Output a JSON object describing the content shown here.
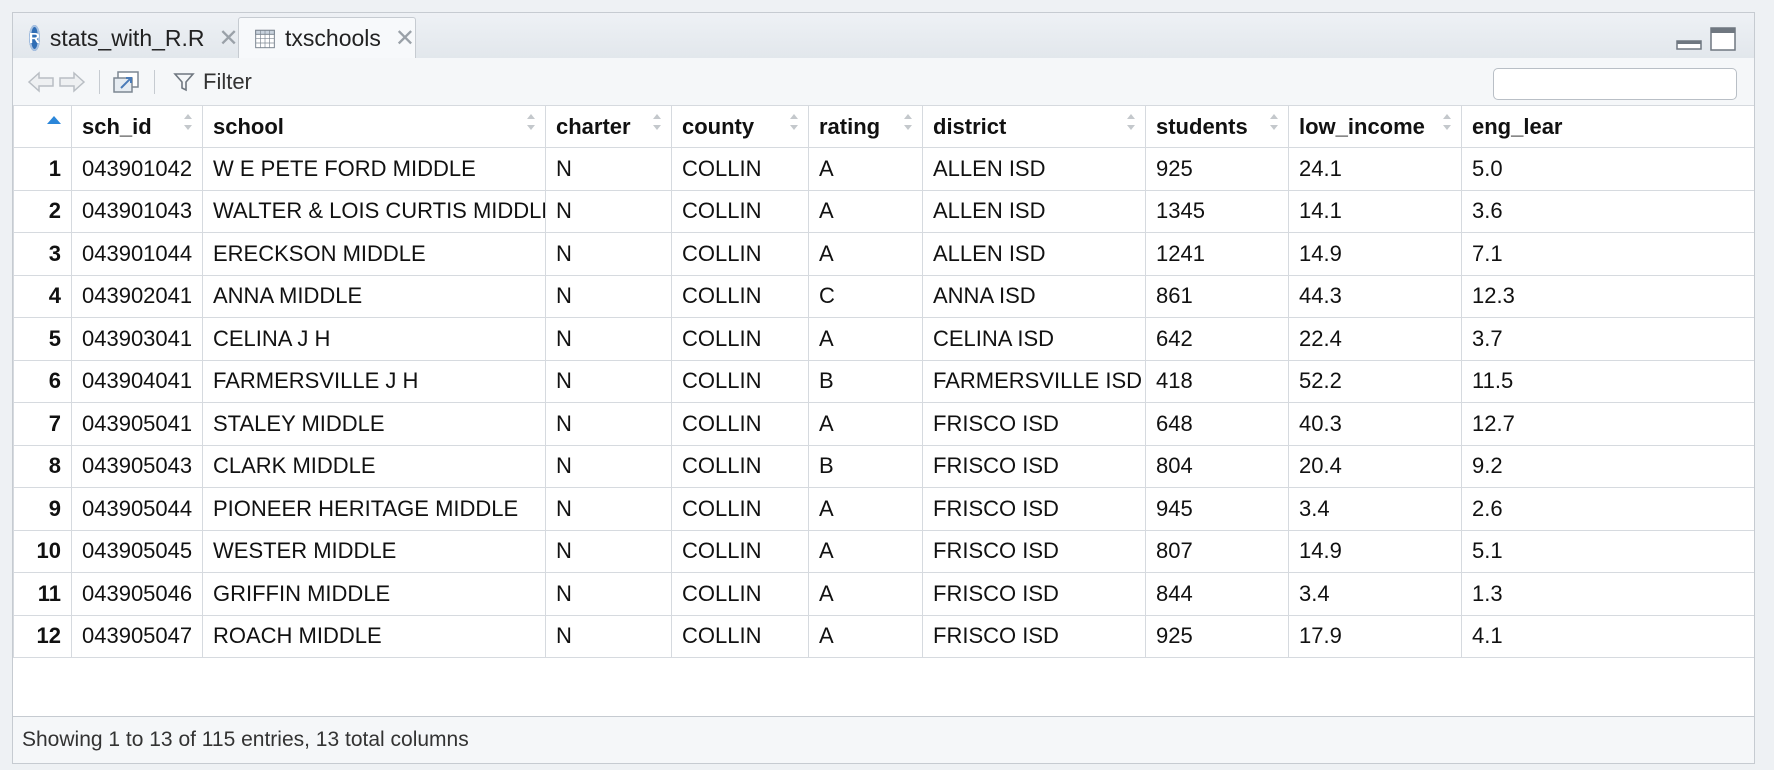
{
  "tabs": [
    {
      "label": "stats_with_R.R",
      "icon": "r-script-icon"
    },
    {
      "label": "txschools",
      "icon": "data-grid-icon"
    }
  ],
  "toolbar": {
    "filter_label": "Filter",
    "search_placeholder": ""
  },
  "table": {
    "columns": [
      "sch_id",
      "school",
      "charter",
      "county",
      "rating",
      "district",
      "students",
      "low_income",
      "eng_lear"
    ],
    "rows": [
      {
        "n": "1",
        "cells": [
          "043901042",
          "W E PETE FORD MIDDLE",
          "N",
          "COLLIN",
          "A",
          "ALLEN ISD",
          "925",
          "24.1",
          "5.0"
        ]
      },
      {
        "n": "2",
        "cells": [
          "043901043",
          "WALTER & LOIS CURTIS MIDDLE",
          "N",
          "COLLIN",
          "A",
          "ALLEN ISD",
          "1345",
          "14.1",
          "3.6"
        ]
      },
      {
        "n": "3",
        "cells": [
          "043901044",
          "ERECKSON MIDDLE",
          "N",
          "COLLIN",
          "A",
          "ALLEN ISD",
          "1241",
          "14.9",
          "7.1"
        ]
      },
      {
        "n": "4",
        "cells": [
          "043902041",
          "ANNA MIDDLE",
          "N",
          "COLLIN",
          "C",
          "ANNA ISD",
          "861",
          "44.3",
          "12.3"
        ]
      },
      {
        "n": "5",
        "cells": [
          "043903041",
          "CELINA J H",
          "N",
          "COLLIN",
          "A",
          "CELINA ISD",
          "642",
          "22.4",
          "3.7"
        ]
      },
      {
        "n": "6",
        "cells": [
          "043904041",
          "FARMERSVILLE J H",
          "N",
          "COLLIN",
          "B",
          "FARMERSVILLE ISD",
          "418",
          "52.2",
          "11.5"
        ]
      },
      {
        "n": "7",
        "cells": [
          "043905041",
          "STALEY MIDDLE",
          "N",
          "COLLIN",
          "A",
          "FRISCO ISD",
          "648",
          "40.3",
          "12.7"
        ]
      },
      {
        "n": "8",
        "cells": [
          "043905043",
          "CLARK MIDDLE",
          "N",
          "COLLIN",
          "B",
          "FRISCO ISD",
          "804",
          "20.4",
          "9.2"
        ]
      },
      {
        "n": "9",
        "cells": [
          "043905044",
          "PIONEER HERITAGE MIDDLE",
          "N",
          "COLLIN",
          "A",
          "FRISCO ISD",
          "945",
          "3.4",
          "2.6"
        ]
      },
      {
        "n": "10",
        "cells": [
          "043905045",
          "WESTER MIDDLE",
          "N",
          "COLLIN",
          "A",
          "FRISCO ISD",
          "807",
          "14.9",
          "5.1"
        ]
      },
      {
        "n": "11",
        "cells": [
          "043905046",
          "GRIFFIN MIDDLE",
          "N",
          "COLLIN",
          "A",
          "FRISCO ISD",
          "844",
          "3.4",
          "1.3"
        ]
      },
      {
        "n": "12",
        "cells": [
          "043905047",
          "ROACH MIDDLE",
          "N",
          "COLLIN",
          "A",
          "FRISCO ISD",
          "925",
          "17.9",
          "4.1"
        ]
      }
    ]
  },
  "footer": {
    "status": "Showing 1 to 13 of 115 entries, 13 total columns"
  },
  "colors": {
    "accent": "#2b86d9",
    "border": "#c6cbd1",
    "gridline": "#d6dadf"
  }
}
